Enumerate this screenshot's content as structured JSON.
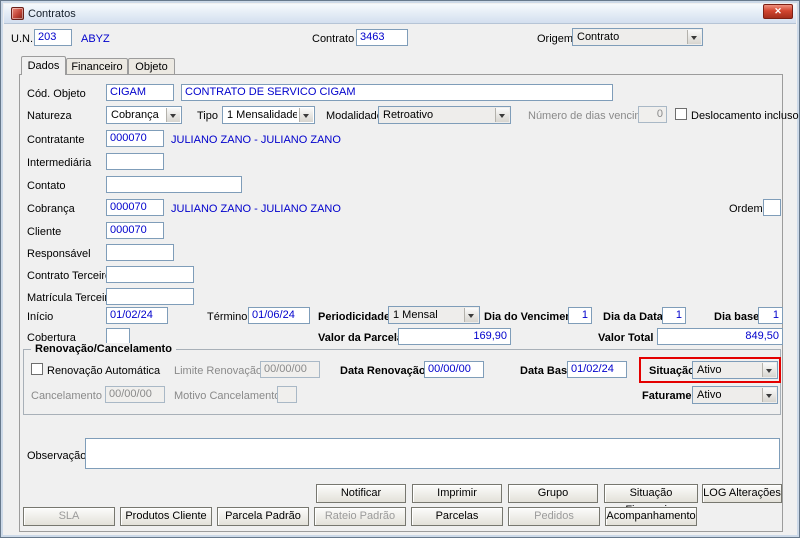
{
  "window": {
    "title": "Contratos",
    "close_glyph": "✕"
  },
  "colors": {
    "value_text": "#0000cc",
    "highlight_border": "#e40000",
    "disabled_text": "#8a8a8a",
    "dialog_bg": "#f0f0f0"
  },
  "header": {
    "un_label": "U.N.",
    "un_value": "203",
    "un_name": "ABYZ",
    "contrato_label": "Contrato",
    "contrato_value": "3463",
    "origem_label": "Origem",
    "origem_value": "Contrato"
  },
  "tabs": [
    {
      "label": "Dados"
    },
    {
      "label": "Financeiro"
    },
    {
      "label": "Objeto"
    }
  ],
  "form": {
    "cod_objeto_label": "Cód. Objeto",
    "cod_objeto_value": "CIGAM",
    "cod_objeto_desc": "CONTRATO DE SERVICO CIGAM",
    "natureza_label": "Natureza",
    "natureza_value": "Cobrança",
    "tipo_label": "Tipo",
    "tipo_value": "1 Mensalidade",
    "modalidade_label": "Modalidade",
    "modalidade_value": "Retroativo",
    "dias_vencimento_label": "Número de dias vencimento",
    "dias_vencimento_value": "0",
    "deslocamento_label": "Deslocamento incluso",
    "contratante_label": "Contratante",
    "contratante_value": "000070",
    "contratante_desc": "JULIANO ZANO - JULIANO ZANO",
    "intermediaria_label": "Intermediária",
    "intermediaria_value": "",
    "contato_label": "Contato",
    "contato_value": "",
    "cobranca_label": "Cobrança",
    "cobranca_value": "000070",
    "cobranca_desc": "JULIANO ZANO - JULIANO ZANO",
    "ordem_label": "Ordem",
    "ordem_value": "",
    "cliente_label": "Cliente",
    "cliente_value": "000070",
    "responsavel_label": "Responsável",
    "responsavel_value": "",
    "contrato_terceiro_label": "Contrato Terceiro",
    "contrato_terceiro_value": "",
    "matricula_terceiro_label": "Matrícula Terceiro",
    "matricula_terceiro_value": "",
    "inicio_label": "Início",
    "inicio_value": "01/02/24",
    "termino_label": "Término",
    "termino_value": "01/06/24",
    "periodicidade_label": "Periodicidade",
    "periodicidade_value": "1 Mensal",
    "dia_vencimento_label": "Dia do Vencimento",
    "dia_vencimento_value": "1",
    "dia_data_label": "Dia da Data",
    "dia_data_value": "1",
    "dia_base_label": "Dia base",
    "dia_base_value": "1",
    "cobertura_label": "Cobertura",
    "cobertura_value": "",
    "valor_parcela_label": "Valor da Parcela",
    "valor_parcela_value": "169,90",
    "valor_total_label": "Valor Total",
    "valor_total_value": "849,50"
  },
  "renovacao": {
    "group_title": "Renovação/Cancelamento",
    "renovacao_automatica_label": "Renovação Automática",
    "limite_renovacao_label": "Limite Renovação",
    "limite_renovacao_value": "00/00/00",
    "data_renovacao_label": "Data Renovação",
    "data_renovacao_value": "00/00/00",
    "data_base_label": "Data Base",
    "data_base_value": "01/02/24",
    "situacao_label": "Situação",
    "situacao_value": "Ativo",
    "cancelamento_label": "Cancelamento",
    "cancelamento_value": "00/00/00",
    "motivo_cancelamento_label": "Motivo Cancelamento",
    "motivo_cancelamento_value": "",
    "faturamento_label": "Faturamento",
    "faturamento_value": "Ativo"
  },
  "observacao": {
    "label": "Observação",
    "value": ""
  },
  "actions_row1": [
    {
      "label": "Notificar"
    },
    {
      "label": "Imprimir"
    },
    {
      "label": "Grupo"
    },
    {
      "label": "Situação Financeira"
    },
    {
      "label": "LOG Alterações"
    }
  ],
  "actions_row2": [
    {
      "label": "SLA",
      "disabled": true
    },
    {
      "label": "Produtos Cliente",
      "disabled": false
    },
    {
      "label": "Parcela Padrão",
      "disabled": false
    },
    {
      "label": "Rateio Padrão",
      "disabled": true
    },
    {
      "label": "Parcelas",
      "disabled": false
    },
    {
      "label": "Pedidos",
      "disabled": true
    },
    {
      "label": "Acompanhamento",
      "disabled": false
    }
  ]
}
